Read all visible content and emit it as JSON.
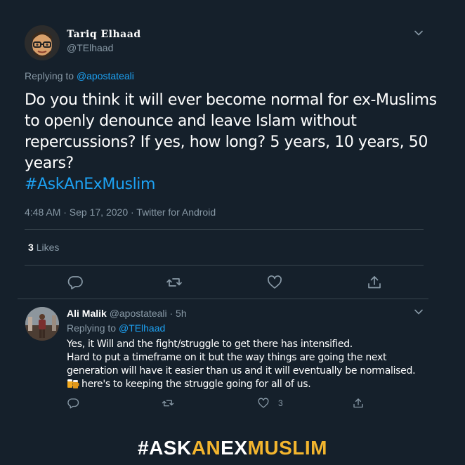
{
  "tweet": {
    "display_name": "Tariq Elhaad",
    "handle": "@TElhaad",
    "replying_prefix": "Replying to",
    "replying_to": "@apostateali",
    "text": "Do you think it will ever become normal for ex-Muslims to openly denounce and leave Islam without repercussions? If yes, how long? 5 years, 10 years, 50 years?",
    "hashtag": "#AskAnExMuslim",
    "timestamp": "4:48 AM · Sep 17, 2020 · Twitter for Android",
    "likes_count": "3",
    "likes_label": "Likes",
    "actions": [
      "reply-icon",
      "retweet-icon",
      "like-icon",
      "share-icon"
    ]
  },
  "reply": {
    "display_name": "Ali Malik",
    "handle_time": "@apostateali · 5h",
    "replying_prefix": "Replying to",
    "replying_to": "@TElhaad",
    "lines": [
      "Yes, it Will and the fight/struggle to get there has intensified.",
      "Hard to put a timeframe on it but the way things are going the next",
      "generation will have it easier than us and it will eventually be normalised.",
      "here's to keeping the struggle going for all of us."
    ],
    "emoji": "beer-mugs-icon",
    "like_count": "3"
  },
  "banner": {
    "part1": "#ASK",
    "part2": "AN",
    "part3": "EX",
    "part4": "MUSLIM"
  },
  "colors": {
    "background": "#15202b",
    "link": "#1da1f2",
    "muted": "#8899a6",
    "divider": "#38444d",
    "banner_yellow": "#f2b52e"
  }
}
